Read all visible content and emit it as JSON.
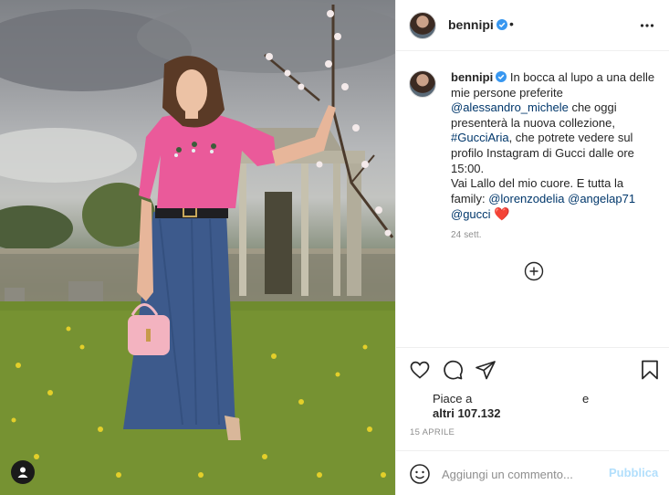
{
  "post": {
    "username": "bennipi",
    "header_separator": "•",
    "caption": {
      "username": "bennipi",
      "text_1": "In bocca al lupo a una delle mie persone preferite",
      "mention_1": "@alessandro_michele",
      "text_2": "che oggi presenterà la nuova collezione,",
      "hashtag": "#GucciAria",
      "text_3": ", che potrete vedere sul profilo Instagram di Gucci dalle ore 15:00.",
      "text_4": "Vai Lallo del mio cuore. E tutta la family:",
      "mention_2": "@lorenzodelia",
      "mention_3": "@angelap71",
      "mention_4": "@gucci",
      "emoji": "❤️",
      "date": "24 sett."
    },
    "likes": {
      "prefix": "Piace a",
      "suffix": "e",
      "count_text": "altri 107.132"
    },
    "timestamp": "15 APRILE",
    "comment": {
      "placeholder": "Aggiungi un commento...",
      "publish_label": "Pubblica"
    }
  },
  "icons": {
    "verified": "verified-badge-icon",
    "more": "more-options-icon",
    "load_more": "plus-circle-icon",
    "like": "heart-icon",
    "comment": "comment-bubble-icon",
    "share": "paper-plane-icon",
    "save": "bookmark-icon",
    "emoji": "smiley-icon",
    "user_tag": "user-tag-icon"
  },
  "colors": {
    "text": "#262626",
    "secondary": "#8e8e8e",
    "link": "#00376b",
    "verified": "#3897f0",
    "publish_disabled": "#b2dffc",
    "border": "#efefef"
  }
}
